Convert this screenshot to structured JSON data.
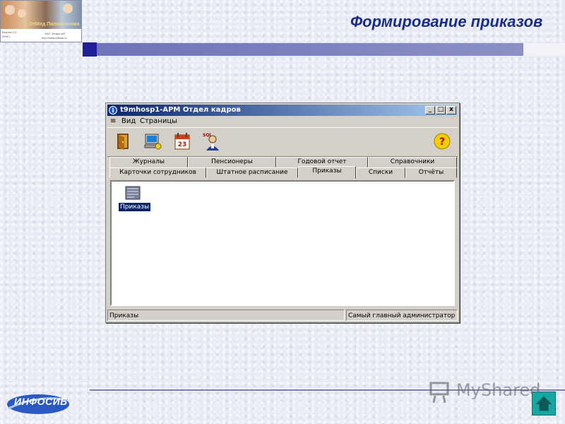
{
  "header": {
    "title": "Формирование приказов",
    "logo_brand": "ЭлМед Поликлиника",
    "logo_small_left": "Версия 2.0",
    "logo_small_right": "ЗАО \"ИнфоСиб\"",
    "logo_small_url": "http://www.infosib.ru",
    "logo_small_year": "2006 г."
  },
  "window": {
    "title": "t9mhosp1-АРМ Отдел кадров",
    "title_buttons": [
      "_",
      "□",
      "x"
    ],
    "menu": [
      "≡",
      "Вид",
      "Страницы"
    ],
    "toolbar": {
      "exit_icon": "door-icon",
      "computer_icon": "computer-icon",
      "calendar_icon": "calendar-icon",
      "calendar_day": "23",
      "sql_user_icon": "sql-user-icon",
      "sql_label": "SQL",
      "help_icon": "help-icon",
      "help_glyph": "?"
    },
    "tabs_row1": [
      "Журналы",
      "Пенсионеры",
      "Годовой отчет",
      "Справочники"
    ],
    "tabs_row2": [
      "Карточки сотрудников",
      "Штатное расписание",
      "Приказы",
      "Списки",
      "Отчёты"
    ],
    "active_tab": "Приказы",
    "content_item_label": "Приказы",
    "status_left": "Приказы",
    "status_right": "Самый главный администратор"
  },
  "footer": {
    "brand": "ИНФОСИБ",
    "watermark": "MyShared"
  },
  "colors": {
    "title_blue": "#1a2c8a",
    "stripe": "#7f83c0",
    "selection": "#0a246a",
    "nav_button": "#17a7a3"
  }
}
